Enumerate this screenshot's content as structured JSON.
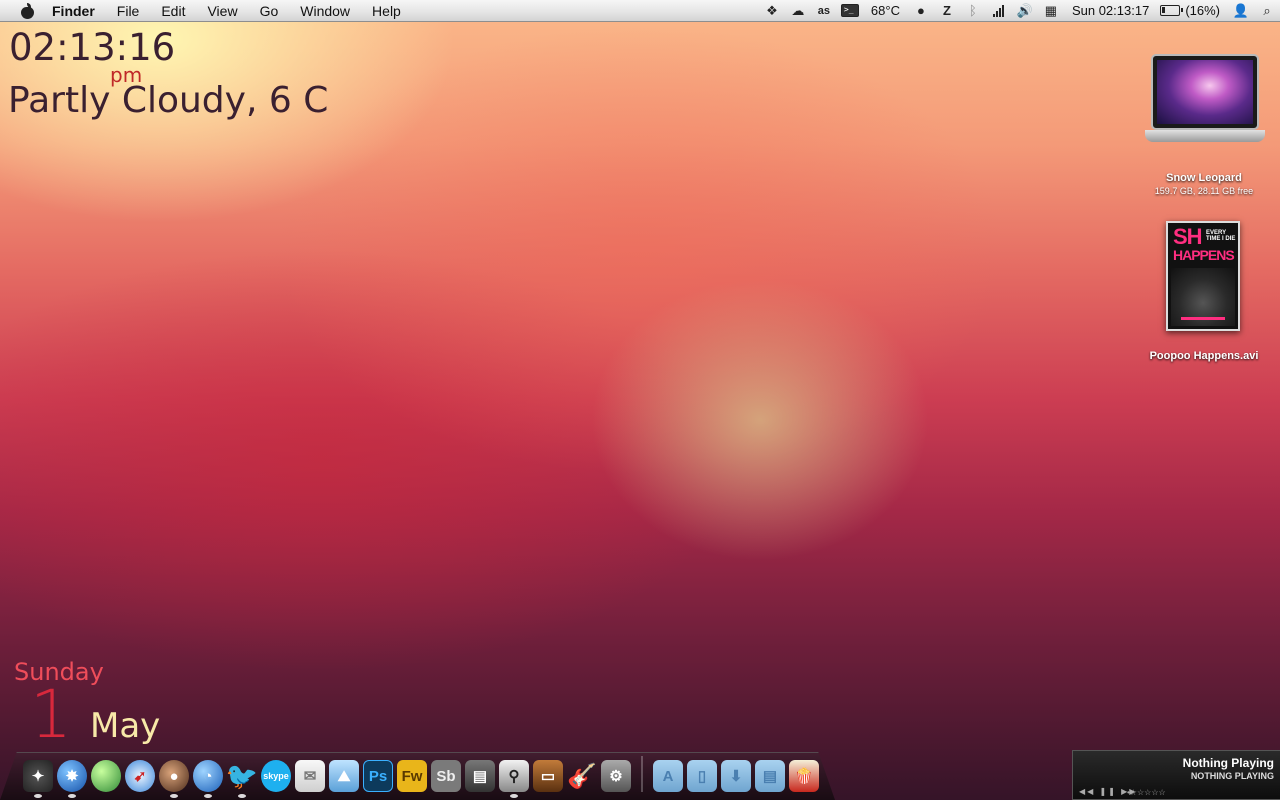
{
  "menubar": {
    "app_name": "Finder",
    "menus": [
      "File",
      "Edit",
      "View",
      "Go",
      "Window",
      "Help"
    ],
    "temperature": "68°C",
    "datetime": "Sun 02:13:17",
    "battery": "(16%)"
  },
  "clock": {
    "time": "02:13:16",
    "ampm": "pm",
    "weather": "Partly Cloudy, 6 C"
  },
  "calendar": {
    "day_name": "Sunday",
    "date": "1",
    "month": "May"
  },
  "desktop": {
    "drive_name": "Snow Leopard",
    "drive_info": "159.7 GB, 28.11 GB free",
    "movie_name": "Poopoo Happens.avi",
    "poster_title_1": "SH",
    "poster_title_2": "HAPPENS",
    "poster_tagline": "EVERY TIME I DIE"
  },
  "itunes": {
    "title": "Nothing Playing",
    "subtitle": "NOTHING PLAYING",
    "controls": "◀◀ ❚❚ ▶▶",
    "rating": "•☆☆☆☆☆"
  },
  "dock": {
    "ps_label": "Ps",
    "fw_label": "Fw",
    "sb_label": "Sb",
    "skype_label": "skype"
  }
}
